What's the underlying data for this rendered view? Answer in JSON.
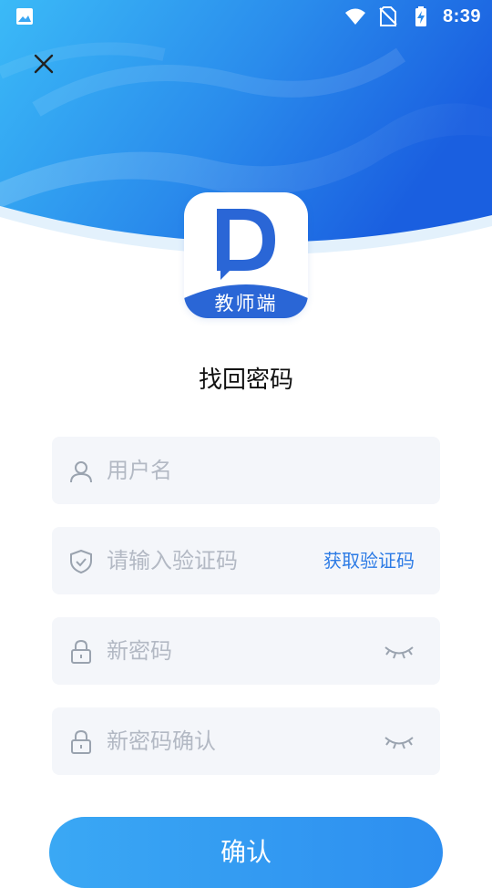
{
  "status_bar": {
    "time": "8:39",
    "icons": [
      "image-icon",
      "wifi-icon",
      "no-sim-icon",
      "battery-charging-icon"
    ]
  },
  "header": {
    "close_icon": "close-icon",
    "colors": {
      "gradient_start": "#3bb4f6",
      "gradient_end": "#1a5fe0"
    }
  },
  "logo": {
    "letter": "D",
    "label": "教师端",
    "color": "#2a66d6"
  },
  "title": "找回密码",
  "form": {
    "username": {
      "placeholder": "用户名",
      "icon": "user-icon"
    },
    "code": {
      "placeholder": "请输入验证码",
      "icon": "shield-icon",
      "get_code_label": "获取验证码"
    },
    "new_password": {
      "placeholder": "新密码",
      "icon": "lock-icon",
      "toggle_icon": "eye-closed-icon"
    },
    "confirm_password": {
      "placeholder": "新密码确认",
      "icon": "lock-icon",
      "toggle_icon": "eye-closed-icon"
    }
  },
  "confirm_button": {
    "label": "确认"
  },
  "colors": {
    "accent": "#2c7be5",
    "field_bg": "#f4f6fa",
    "placeholder": "#b3b9c4"
  }
}
